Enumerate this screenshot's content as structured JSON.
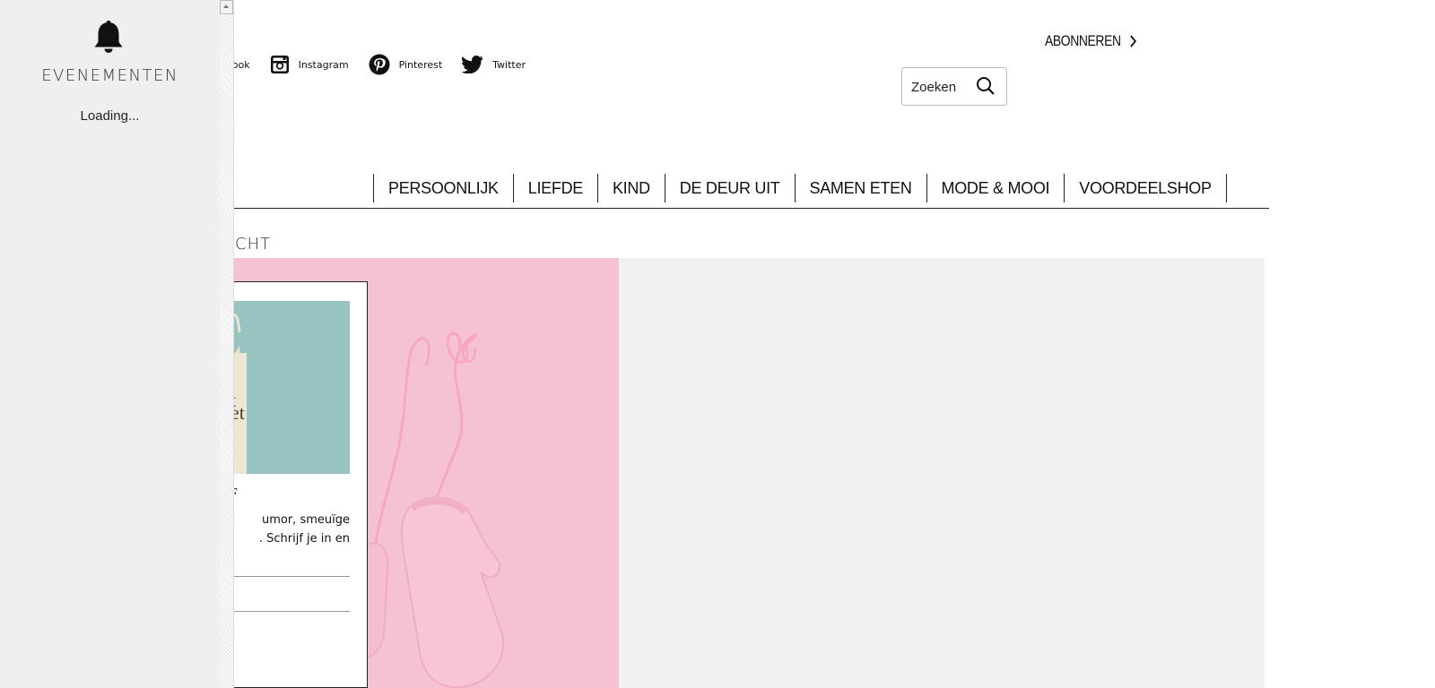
{
  "sidebar": {
    "title": "EVENEMENTEN",
    "status": "Loading..."
  },
  "social": [
    {
      "label": "Facebook",
      "visible_text": "ebook",
      "icon": "facebook-icon"
    },
    {
      "label": "Instagram",
      "icon": "instagram-icon"
    },
    {
      "label": "Pinterest",
      "icon": "pinterest-icon"
    },
    {
      "label": "Twitter",
      "icon": "twitter-icon"
    }
  ],
  "header": {
    "subscribe_label": "ABONNEREN",
    "search_placeholder": "Zoeken"
  },
  "nav": {
    "items": [
      "PERSOONLIJK",
      "LIEFDE",
      "KIND",
      "DE DEUR UIT",
      "SAMEN ETEN",
      "MODE & MOOI",
      "VOORDEELSHOP"
    ]
  },
  "main": {
    "section_label": "CHT"
  },
  "newsletter_card": {
    "heading": "EF",
    "text_line1": "umor, smeuïge",
    "text_line2": ". Schrijf je in en",
    "bag_text": "t et"
  },
  "colors": {
    "hero_bg": "#f5c2d3",
    "panel_bg": "#f1f1f1",
    "card_image_bg": "#97c4c1",
    "sidebar_bg": "#efefef"
  }
}
